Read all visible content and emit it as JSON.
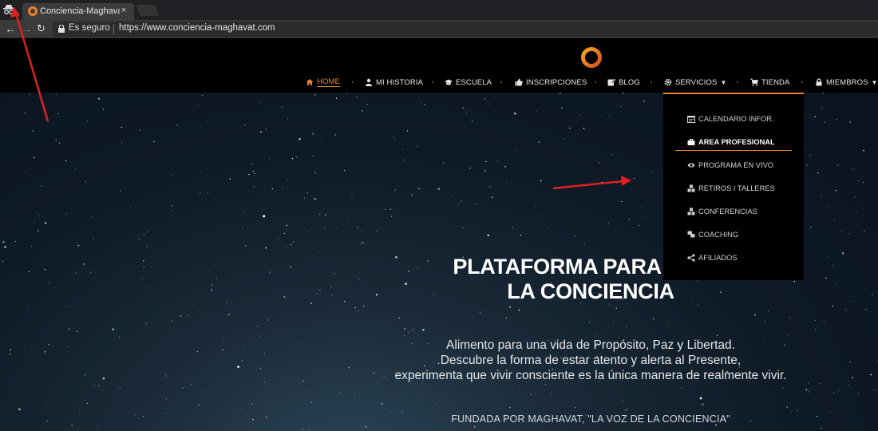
{
  "browser": {
    "tab_title": "Conciencia-Maghavat",
    "tab_close": "×",
    "secure_label": "Es seguro",
    "url": "https://www.conciencia-maghavat.com",
    "icons": [
      "incognito-icon",
      "back-arrow-icon",
      "forward-arrow-icon",
      "reload-icon",
      "lock-icon",
      "favicon-ring-icon"
    ]
  },
  "nav": {
    "items": [
      {
        "label": "HOME",
        "icon": "home-icon"
      },
      {
        "label": "MI HISTORIA",
        "icon": "user-icon"
      },
      {
        "label": "ESCUELA",
        "icon": "graduation-cap-icon"
      },
      {
        "label": "INSCRIPCIONES",
        "icon": "thumbs-up-icon"
      },
      {
        "label": "BLOG",
        "icon": "edit-icon"
      },
      {
        "label": "SERVICIOS",
        "icon": "gear-icon"
      },
      {
        "label": "TIENDA",
        "icon": "cart-icon"
      },
      {
        "label": "MIEMBROS",
        "icon": "lock-icon"
      }
    ],
    "active": "HOME",
    "open_menu": "SERVICIOS"
  },
  "dropdown": {
    "items": [
      {
        "label": "CALENDARIO INFOR.",
        "icon": "calendar-icon"
      },
      {
        "label": "AREA PROFESIONAL",
        "icon": "briefcase-icon"
      },
      {
        "label": "PROGRAMA EN VIVO",
        "icon": "eye-icon"
      },
      {
        "label": "RETIROS / TALLERES",
        "icon": "cubes-icon"
      },
      {
        "label": "CONFERENCIAS",
        "icon": "cubes-icon"
      },
      {
        "label": "COACHING",
        "icon": "chat-icon"
      },
      {
        "label": "AFILIADOS",
        "icon": "share-icon"
      }
    ],
    "highlighted": "AREA PROFESIONAL"
  },
  "hero": {
    "title_line1": "PLATAFORMA PARA EL DE",
    "title_line2": "LA CONCIENCIA",
    "text_line1": "Alimento para una vida de Propósito, Paz y Libertad.",
    "text_line2": "Descubre la forma de estar atento y alerta al Presente,",
    "text_line3": "experimenta que vivir consciente es la única manera de realmente vivir.",
    "footer": "FUNDADA POR MAGHAVAT, \"LA VOZ DE LA CONCIENCIA\""
  },
  "colors": {
    "accent": "#e8832b",
    "annotation": "#e02020",
    "header_bg": "#000000",
    "sky_bg": "#0e1a26"
  }
}
